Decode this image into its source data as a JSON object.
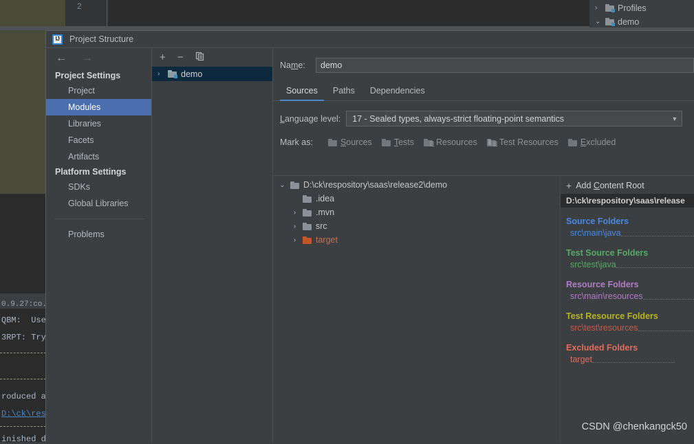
{
  "background": {
    "tab_number": "2",
    "right_tree": [
      {
        "label": "Profiles",
        "arrow": "›",
        "icon": "profiles-folder-icon"
      },
      {
        "label": "demo",
        "arrow": "⌄",
        "icon": "maven-module-icon"
      }
    ],
    "console_lines": [
      {
        "text": "0.9.27:co...",
        "type": "tab"
      },
      {
        "text": "QBM:  Use",
        "type": "plain"
      },
      {
        "text": "3RPT: Try",
        "type": "plain"
      },
      {
        "text": "roduced a",
        "type": "plain"
      },
      {
        "text": "D:\\ck\\res",
        "type": "link"
      },
      {
        "text": "inished d",
        "type": "plain"
      }
    ]
  },
  "dialog": {
    "title": "Project Structure",
    "icon": "intellij-idea-icon",
    "nav": {
      "back": "←",
      "forward": "→"
    },
    "sidebar": {
      "group_project": "Project Settings",
      "project_items": [
        {
          "label": "Project",
          "selected": false
        },
        {
          "label": "Modules",
          "selected": true
        },
        {
          "label": "Libraries",
          "selected": false
        },
        {
          "label": "Facets",
          "selected": false
        },
        {
          "label": "Artifacts",
          "selected": false
        }
      ],
      "group_platform": "Platform Settings",
      "platform_items": [
        {
          "label": "SDKs"
        },
        {
          "label": "Global Libraries"
        }
      ],
      "problems": "Problems"
    },
    "modules_pane": {
      "toolbar": {
        "add": "+",
        "remove": "−",
        "copy": "copy-icon"
      },
      "items": [
        {
          "label": "demo",
          "arrow": "›",
          "selected": true
        }
      ]
    },
    "name_field": {
      "label": "Name:",
      "label_pre": "Na",
      "label_mnemonic": "m",
      "label_post": "e:",
      "value": "demo"
    },
    "tabs": [
      {
        "label": "Sources",
        "active": true
      },
      {
        "label": "Paths",
        "active": false
      },
      {
        "label": "Dependencies",
        "active": false
      }
    ],
    "language_level": {
      "label_pre": "",
      "label_mnemonic": "L",
      "label_post": "anguage level:",
      "value": "17 - Sealed types, always-strict floating-point semantics",
      "chevron": "▼"
    },
    "mark_as": {
      "label": "Mark as:",
      "buttons": [
        {
          "pre": "",
          "mnemonic": "S",
          "post": "ources",
          "icon": "folder-sources-icon"
        },
        {
          "pre": "",
          "mnemonic": "T",
          "post": "ests",
          "icon": "folder-tests-icon"
        },
        {
          "pre": "",
          "mnemonic": "R",
          "post": "esources",
          "icon": "folder-resources-icon"
        },
        {
          "pre": "",
          "mnemonic": "T",
          "post": "est Resources",
          "icon": "folder-test-resources-icon"
        },
        {
          "pre": "",
          "mnemonic": "E",
          "post": "xcluded",
          "icon": "folder-excluded-icon"
        }
      ]
    },
    "file_tree": [
      {
        "label": "D:\\ck\\respository\\saas\\release2\\demo",
        "arrow": "⌄",
        "indent": 0,
        "color": "gray"
      },
      {
        "label": ".idea",
        "arrow": "",
        "indent": 1,
        "color": "gray"
      },
      {
        "label": ".mvn",
        "arrow": "›",
        "indent": 1,
        "color": "gray"
      },
      {
        "label": "src",
        "arrow": "›",
        "indent": 1,
        "color": "gray"
      },
      {
        "label": "target",
        "arrow": "›",
        "indent": 1,
        "color": "orange"
      }
    ],
    "roots_panel": {
      "add_content_root": {
        "plus": "+",
        "pre": "Add ",
        "mnemonic": "C",
        "post": "ontent Root"
      },
      "content_root_path": "D:\\ck\\respository\\saas\\release",
      "categories": [
        {
          "title": "Source Folders",
          "path": "src\\main\\java",
          "color": "#4a88e0"
        },
        {
          "title": "Test Source Folders",
          "path": "src\\test\\java",
          "color": "#58a868"
        },
        {
          "title": "Resource Folders",
          "path": "src\\main\\resources",
          "color": "#b07cc6"
        },
        {
          "title": "Test Resource Folders",
          "path": "src\\test\\resources",
          "color": "#b5b521"
        },
        {
          "title": "Excluded Folders",
          "path": "target",
          "color": "#e06c5c"
        }
      ]
    }
  },
  "watermark": "CSDN @chenkangck50"
}
